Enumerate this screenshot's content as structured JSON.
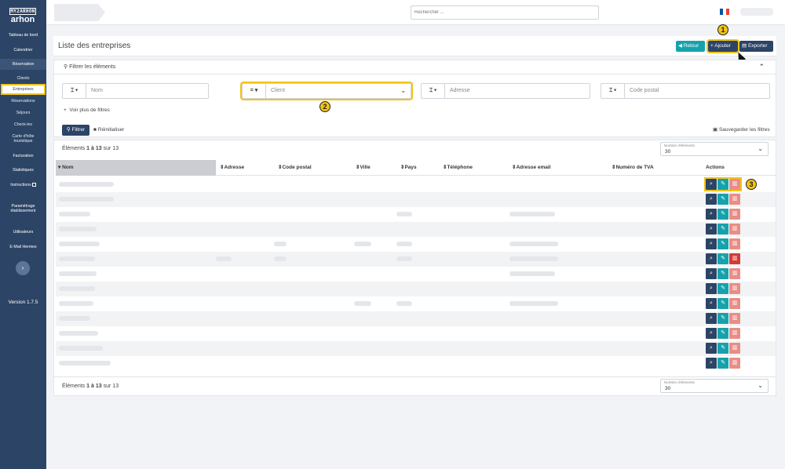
{
  "app": {
    "logo_top": "MY2ARHON",
    "logo_word": "arhon",
    "version": "Version 1.7.5"
  },
  "sidebar": {
    "items": [
      {
        "label": "Tableau de bord"
      },
      {
        "label": "Calendrier"
      },
      {
        "label": "Réservation"
      },
      {
        "label": "Clients"
      },
      {
        "label": "Entreprises"
      },
      {
        "label": "Réservations"
      },
      {
        "label": "Séjours"
      },
      {
        "label": "Check-ins"
      },
      {
        "label": "Carte d'hôte"
      },
      {
        "label": "touristique"
      },
      {
        "label": "Facturation"
      },
      {
        "label": "Statistiques"
      },
      {
        "label": "Instructions"
      },
      {
        "label": "Paramétrage"
      },
      {
        "label": "établissement"
      },
      {
        "label": "Utilisateurs"
      },
      {
        "label": "E-Mail Hermes"
      }
    ],
    "active": "Entreprises",
    "collapse_icon": "›"
  },
  "topbar": {
    "search_placeholder": "Rechercher ...",
    "flag_colors": [
      "#0055a4",
      "#ffffff",
      "#ef4135"
    ]
  },
  "page": {
    "title": "Liste des entreprises",
    "buttons": {
      "retour": "Retour",
      "ajouter": "Ajouter",
      "exporter": "Exporter"
    },
    "markers": [
      "1",
      "2",
      "3"
    ]
  },
  "filters": {
    "header": "Filtrer les éléments",
    "fields": [
      {
        "op": "⌶ ▾",
        "placeholder": "Nom"
      },
      {
        "op": "= ▾",
        "placeholder": "Client"
      },
      {
        "op": "⌶ ▾",
        "placeholder": "Adresse"
      },
      {
        "op": "⌶ ▾",
        "placeholder": "Code postal"
      }
    ],
    "more": "Voir plus de filtres",
    "apply": "Filtrer",
    "reset": "Réinitialiser",
    "save": "Sauvegarder les filtres"
  },
  "table": {
    "count_prefix": "Éléments",
    "count_from": "1",
    "count_sep": "à",
    "count_to": "13",
    "count_total_prefix": "sur",
    "count_total": "13",
    "page_size_label": "Nombre d'éléments",
    "page_size_value": "30",
    "columns": [
      {
        "label": "Nom"
      },
      {
        "label": "Adresse"
      },
      {
        "label": "Code postal"
      },
      {
        "label": "Ville"
      },
      {
        "label": "Pays"
      },
      {
        "label": "Téléphone"
      },
      {
        "label": "Adresse email"
      },
      {
        "label": "Numéro de TVA"
      },
      {
        "label": "Actions"
      }
    ],
    "row_count": 13,
    "accent_colors": {
      "primary": "#2c4465",
      "teal": "#16a2ad",
      "danger_light": "#e98d86",
      "danger": "#d63a34",
      "highlight": "#f2c318"
    }
  }
}
